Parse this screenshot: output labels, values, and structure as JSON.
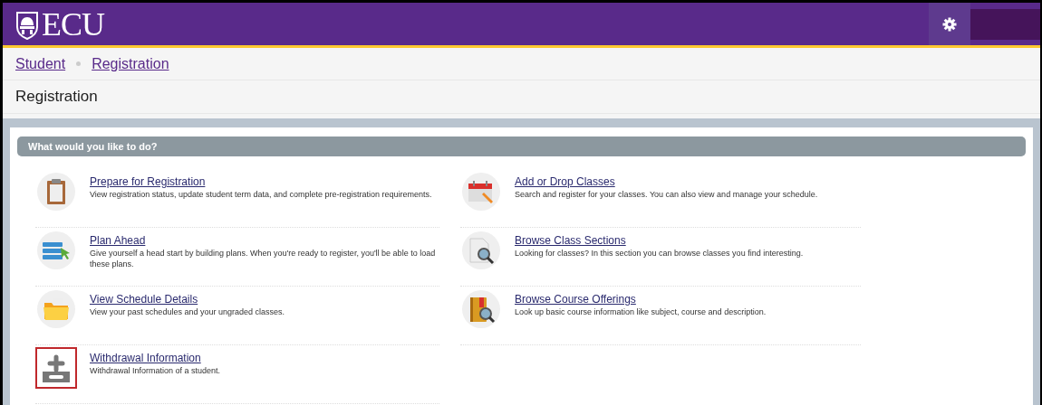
{
  "header": {
    "logo": "ECU"
  },
  "breadcrumb": [
    {
      "label": "Student"
    },
    {
      "label": "Registration"
    }
  ],
  "page_title": "Registration",
  "panel": {
    "title": "What would you like to do?",
    "columns": [
      [
        {
          "kind": "clipboard",
          "title": "Prepare for Registration",
          "description": "View registration status, update student term data, and complete pre-registration requirements.",
          "highlighted": false
        },
        {
          "kind": "plan",
          "title": "Plan Ahead",
          "description": "Give yourself a head start by building plans. When you're ready to register, you'll be able to load these plans.",
          "highlighted": false
        },
        {
          "kind": "folder",
          "title": "View Schedule Details",
          "description": "View your past schedules and your ungraded classes.",
          "highlighted": false
        },
        {
          "kind": "plusminus",
          "title": "Withdrawal Information",
          "description": "Withdrawal Information of a student.",
          "highlighted": true
        }
      ],
      [
        {
          "kind": "calendar",
          "title": "Add or Drop Classes",
          "description": "Search and register for your classes. You can also view and manage your schedule.",
          "highlighted": false
        },
        {
          "kind": "docsearch",
          "title": "Browse Class Sections",
          "description": "Looking for classes? In this section you can browse classes you find interesting.",
          "highlighted": false
        },
        {
          "kind": "book",
          "title": "Browse Course Offerings",
          "description": "Look up basic course information like subject, course and description.",
          "highlighted": false
        }
      ]
    ]
  }
}
